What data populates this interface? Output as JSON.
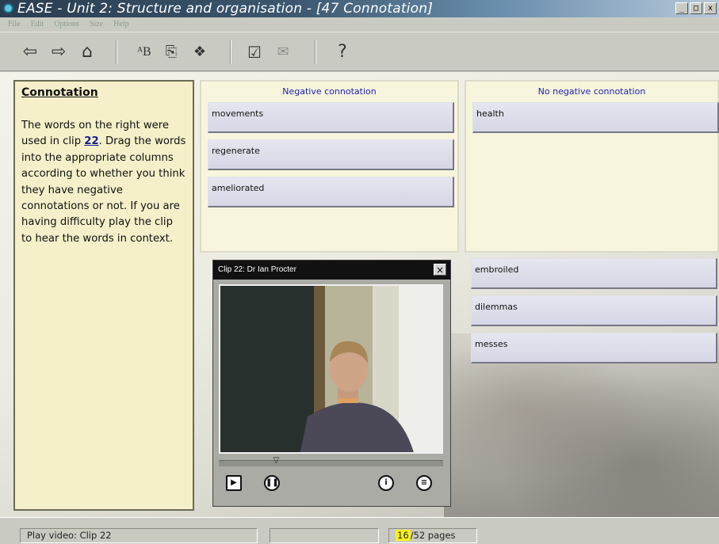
{
  "window": {
    "title": "EASE - Unit 2: Structure and organisation - [47 Connotation]",
    "controls": [
      "_",
      "□",
      "x"
    ]
  },
  "menu": [
    "File",
    "Edit",
    "Options",
    "Size",
    "Help"
  ],
  "toolbar": {
    "buttons": [
      "back-arrow-icon",
      "forward-arrow-icon",
      "home-icon",
      "glossary-icon",
      "notes-icon",
      "help-topics-icon",
      "check-answer-icon",
      "email-icon",
      "question-icon"
    ]
  },
  "instructions": {
    "title": "Connotation",
    "text_before": "The words on the right were used in clip ",
    "clip_number": "22",
    "text_after": ".  Drag the words into the appropriate columns according to whether you think they have negative connotations or not.  If you are having difficulty play the clip to hear the words in context."
  },
  "columns": {
    "negative": {
      "header": "Negative connotation",
      "words": [
        "movements",
        "regenerate",
        "ameliorated"
      ]
    },
    "non_negative": {
      "header": "No negative connotation",
      "words": [
        "health"
      ]
    }
  },
  "word_bank": [
    "embroiled",
    "dilemmas",
    "messes"
  ],
  "video": {
    "title": "Clip 22: Dr Ian Procter",
    "close": "×",
    "progress": 0.245,
    "buttons": [
      "play-icon",
      "pause-icon",
      "info-icon",
      "transcript-icon"
    ]
  },
  "status": {
    "message": "Play video: Clip 22",
    "page_current": "16",
    "page_total_text": "/52 pages"
  },
  "colors": {
    "instruction_bg": "#f5f0c9",
    "column_bg": "#f7f6dc",
    "word_box": "#dcdcea",
    "header_text": "#1c1cb8",
    "page_highlight": "#fff21a"
  }
}
